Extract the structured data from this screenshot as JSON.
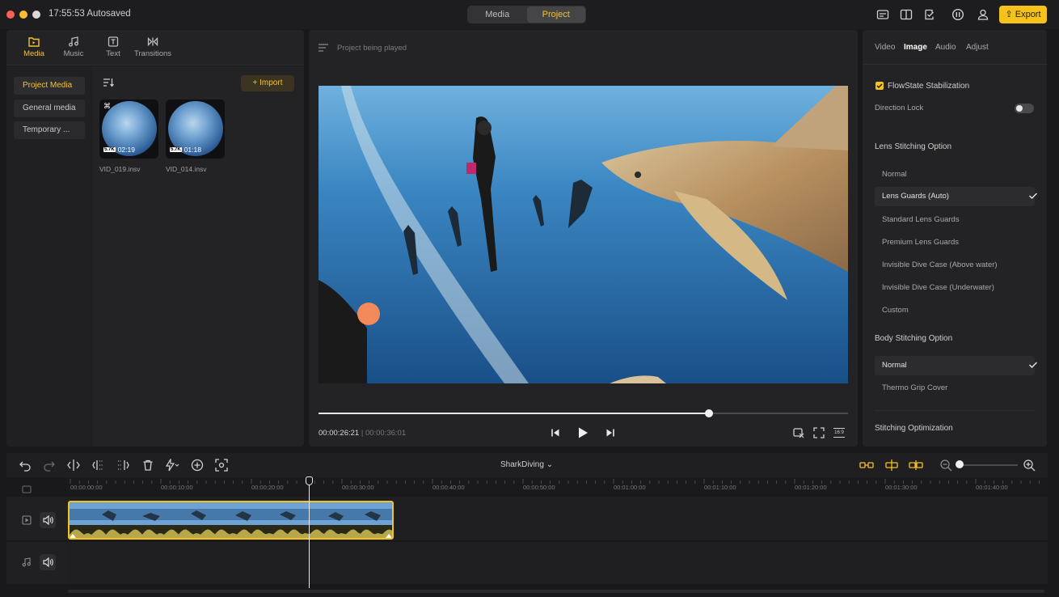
{
  "titlebar": {
    "autosave": "17:55:53 Autosaved",
    "mode_tabs": [
      {
        "label": "Media",
        "active": false
      },
      {
        "label": "Project",
        "active": true
      }
    ],
    "export_label": "Export"
  },
  "media_tabs": [
    {
      "label": "Media",
      "icon": "folder-icon",
      "active": true
    },
    {
      "label": "Music",
      "icon": "music-note-icon",
      "active": false
    },
    {
      "label": "Text",
      "icon": "text-icon",
      "active": false
    },
    {
      "label": "Transitions",
      "icon": "transitions-icon",
      "active": false
    }
  ],
  "left_nav": [
    {
      "label": "Project Media",
      "active": true
    },
    {
      "label": "General media",
      "active": false
    },
    {
      "label": "Temporary ...",
      "active": false
    }
  ],
  "media": {
    "import_label": "Import",
    "files": [
      {
        "name": "VID_019.insv",
        "resolution": "5.7K",
        "duration": "02:19"
      },
      {
        "name": "VID_014.insv",
        "resolution": "5.7K",
        "duration": "01:18"
      }
    ]
  },
  "preview": {
    "header": "Project being played",
    "current_time": "00:00:26:21",
    "separator": "|",
    "total_time": "00:00:36:01",
    "progress_fraction": 0.737,
    "aspect_label": "16:9"
  },
  "right_panel": {
    "tabs": [
      {
        "label": "Video",
        "active": false
      },
      {
        "label": "Image",
        "active": true
      },
      {
        "label": "Audio",
        "active": false
      },
      {
        "label": "Adjust",
        "active": false
      }
    ],
    "flowstate_label": "FlowState Stabilization",
    "flowstate_checked": true,
    "direction_lock_label": "Direction Lock",
    "direction_lock_on": false,
    "lens_heading": "Lens Stitching Option",
    "lens_options": [
      {
        "label": "Normal",
        "selected": false
      },
      {
        "label": "Lens Guards (Auto)",
        "selected": true
      },
      {
        "label": "Standard Lens Guards",
        "selected": false
      },
      {
        "label": "Premium Lens Guards",
        "selected": false
      },
      {
        "label": "Invisible Dive Case (Above water)",
        "selected": false
      },
      {
        "label": "Invisible Dive Case (Underwater)",
        "selected": false
      },
      {
        "label": "Custom",
        "selected": false
      }
    ],
    "body_heading": "Body Stitching Option",
    "body_options": [
      {
        "label": "Normal",
        "selected": true
      },
      {
        "label": "Thermo Grip Cover",
        "selected": false
      }
    ],
    "optimization_heading": "Stitching Optimization"
  },
  "timeline": {
    "project_name": "SharkDiving",
    "ruler_ticks": [
      "00:00:00:00",
      "00:00:10:00",
      "00:00:20:00",
      "00:00:30:00",
      "00:00:40:00",
      "00:00:50:00",
      "00:01:00:00",
      "00:01:10:00",
      "00:01:20:00",
      "00:01:30:00",
      "00:01:40:00"
    ]
  }
}
